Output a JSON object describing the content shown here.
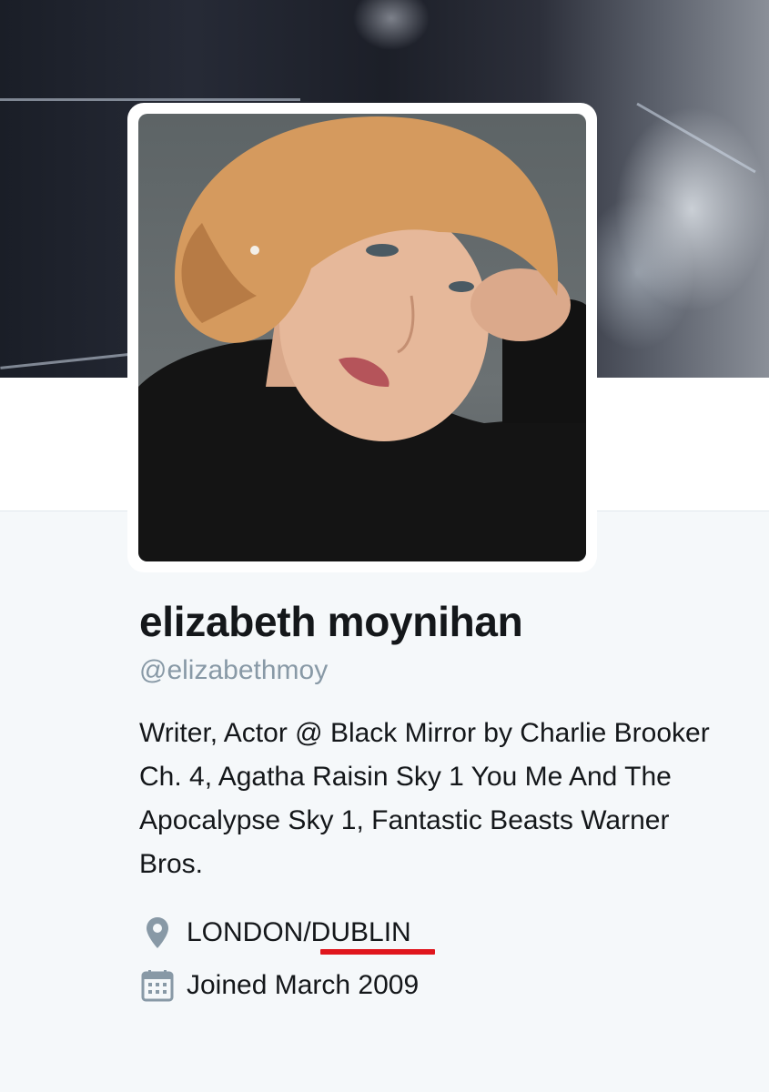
{
  "profile": {
    "display_name": "elizabeth moynihan",
    "handle": "@elizabethmoy",
    "bio": "Writer, Actor @ Black Mirror by Charlie Brooker Ch. 4, Agatha Raisin Sky 1 You Me And The Apocalypse Sky 1, Fantastic Beasts Warner Bros.",
    "location": "LONDON/DUBLIN",
    "joined": "Joined March 2009"
  },
  "icons": {
    "location": "map-pin-icon",
    "joined": "calendar-icon"
  },
  "colors": {
    "name_text": "#14171a",
    "secondary_text": "#8899a6",
    "icon_gray": "#8899a6",
    "annotation_underline": "#e0161d",
    "background": "#f5f8fa"
  }
}
